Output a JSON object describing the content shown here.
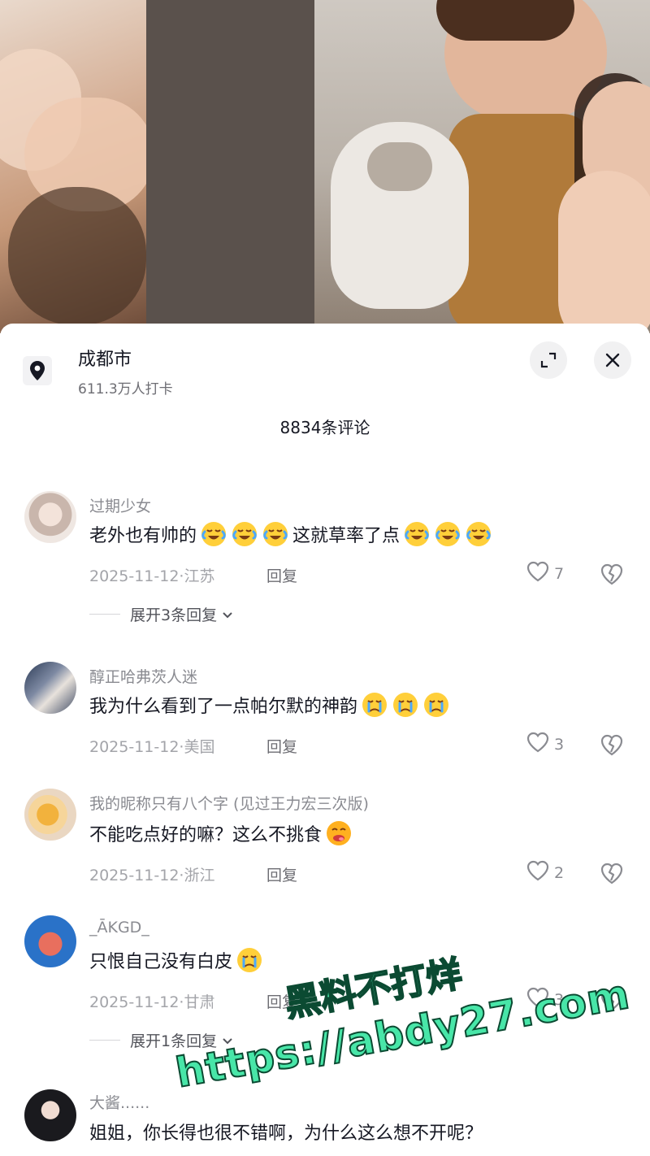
{
  "location": {
    "title": "成都市",
    "subtitle": "611.3万人打卡"
  },
  "header": {
    "comment_count": "8834条评论"
  },
  "comments": [
    {
      "name": "过期少女",
      "text": "老外也有帅的",
      "emoji_before": [
        "crying-laughing",
        "crying-laughing",
        "crying-laughing"
      ],
      "text_after": "这就草率了点",
      "emoji_after": [
        "crying-laughing",
        "crying-laughing",
        "crying-laughing"
      ],
      "meta": "2025-11-12·江苏",
      "reply": "回复",
      "likes": "7",
      "expand": "展开3条回复"
    },
    {
      "name": "醇正哈弗茨人迷",
      "text": "我为什么看到了一点帕尔默的神韵",
      "emoji_after": [
        "crying",
        "crying",
        "crying"
      ],
      "meta": "2025-11-12·美国",
      "reply": "回复",
      "likes": "3"
    },
    {
      "name": "我的昵称只有八个字 (见过王力宏三次版)",
      "text": "不能吃点好的嘛？这么不挑食",
      "emoji_after": [
        "yummy"
      ],
      "meta": "2025-11-12·浙江",
      "reply": "回复",
      "likes": "2"
    },
    {
      "name": "_ĀKGD_",
      "text": "只恨自己没有白皮",
      "emoji_after": [
        "crying"
      ],
      "meta": "2025-11-12·甘肃",
      "reply": "回复",
      "likes": "3",
      "expand": "展开1条回复"
    },
    {
      "name": "大酱......",
      "text": "姐姐，你长得也很不错啊，为什么这么想不开呢？"
    }
  ],
  "watermark": {
    "line1": "黑料不打烊",
    "line2": "https://abdy27.com"
  },
  "colors": {
    "watermark_fill": "#48e6a8",
    "watermark_stroke": "#0b4a32",
    "muted_text": "#8a8b91"
  }
}
